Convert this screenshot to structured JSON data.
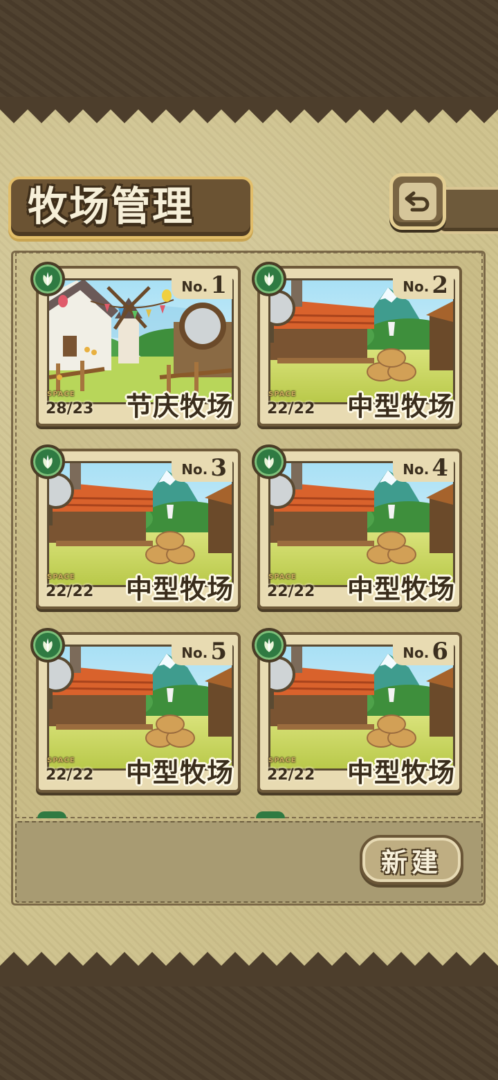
{
  "header": {
    "title": "牧场管理",
    "back_icon": "return-arrow-icon"
  },
  "farms": [
    {
      "no_label": "No.",
      "no": "1",
      "space_label": "SPACE",
      "space": "28/23",
      "name": "节庆牧场",
      "scene": "festival"
    },
    {
      "no_label": "No.",
      "no": "2",
      "space_label": "SPACE",
      "space": "22/22",
      "name": "中型牧场",
      "scene": "medium"
    },
    {
      "no_label": "No.",
      "no": "3",
      "space_label": "SPACE",
      "space": "22/22",
      "name": "中型牧场",
      "scene": "medium"
    },
    {
      "no_label": "No.",
      "no": "4",
      "space_label": "SPACE",
      "space": "22/22",
      "name": "中型牧场",
      "scene": "medium"
    },
    {
      "no_label": "No.",
      "no": "5",
      "space_label": "SPACE",
      "space": "22/22",
      "name": "中型牧场",
      "scene": "medium"
    },
    {
      "no_label": "No.",
      "no": "6",
      "space_label": "SPACE",
      "space": "22/22",
      "name": "中型牧场",
      "scene": "medium"
    }
  ],
  "footer": {
    "new_button_label": "新建"
  },
  "colors": {
    "parchment": "#cfc38f",
    "frame": "#6e5a3a",
    "leaf_badge": "#2f7a42"
  }
}
